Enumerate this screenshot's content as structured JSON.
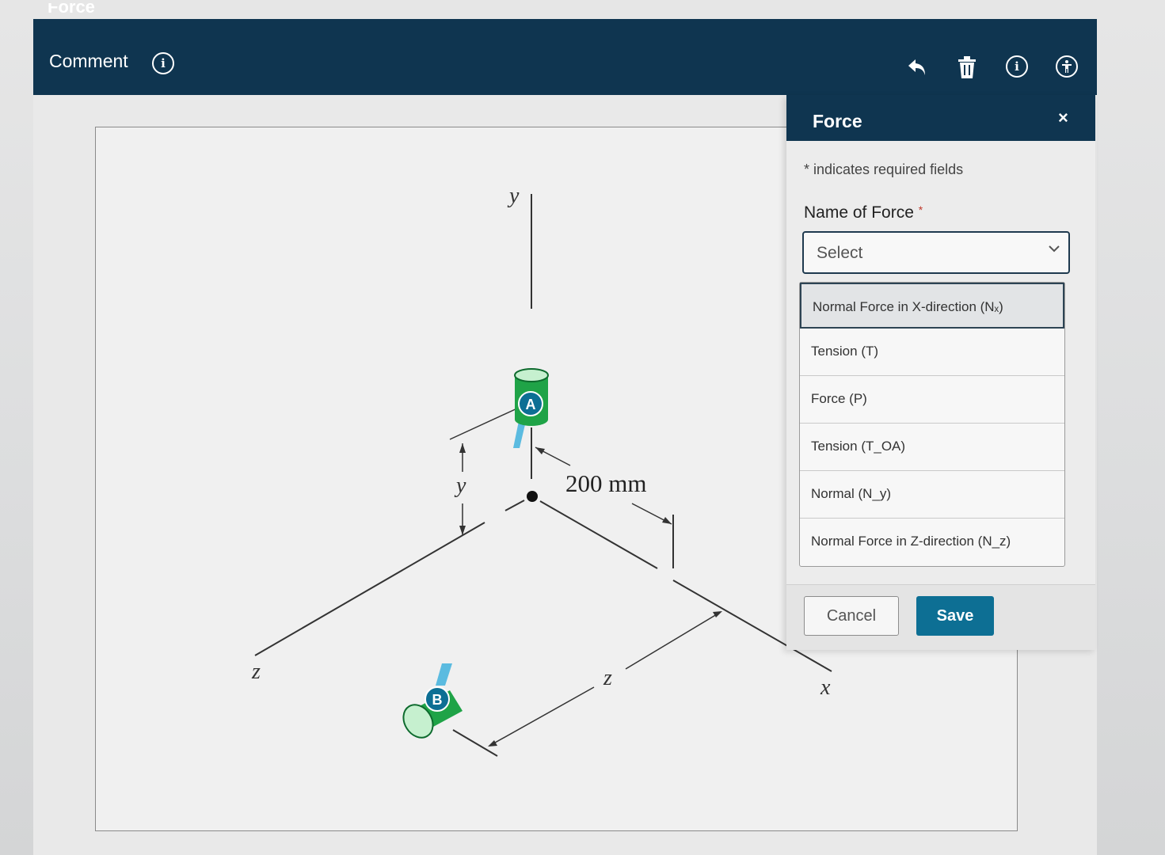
{
  "topbar": {
    "cut_text": "Force",
    "comment_label": "Comment",
    "icons": [
      "info-icon",
      "undo-icon",
      "trash-icon",
      "info-icon",
      "accessibility-icon"
    ]
  },
  "figure": {
    "y_axis": "y",
    "x_axis": "x",
    "z_axis": "z",
    "point_a": "A",
    "point_b": "B",
    "dim_200": "200 mm",
    "dim_y": "y",
    "dim_z": "z"
  },
  "modal": {
    "title": "Force",
    "close": "×",
    "required_note": "* indicates required fields",
    "field_label": "Name of Force",
    "required_star": "*",
    "select_placeholder": "Select",
    "options": [
      "Normal Force in X-direction (Nₓ)",
      "Tension (T)",
      "Force (P)",
      "Tension (T_OA)",
      "Normal (N_y)",
      "Normal Force in Z-direction (N_z)"
    ],
    "cancel_label": "Cancel",
    "save_label": "Save"
  },
  "colors": {
    "header_bg": "#0f3550",
    "save_bg": "#0d6f94",
    "collar_green": "#1fa347",
    "rod_blue": "#5bbbe0"
  }
}
